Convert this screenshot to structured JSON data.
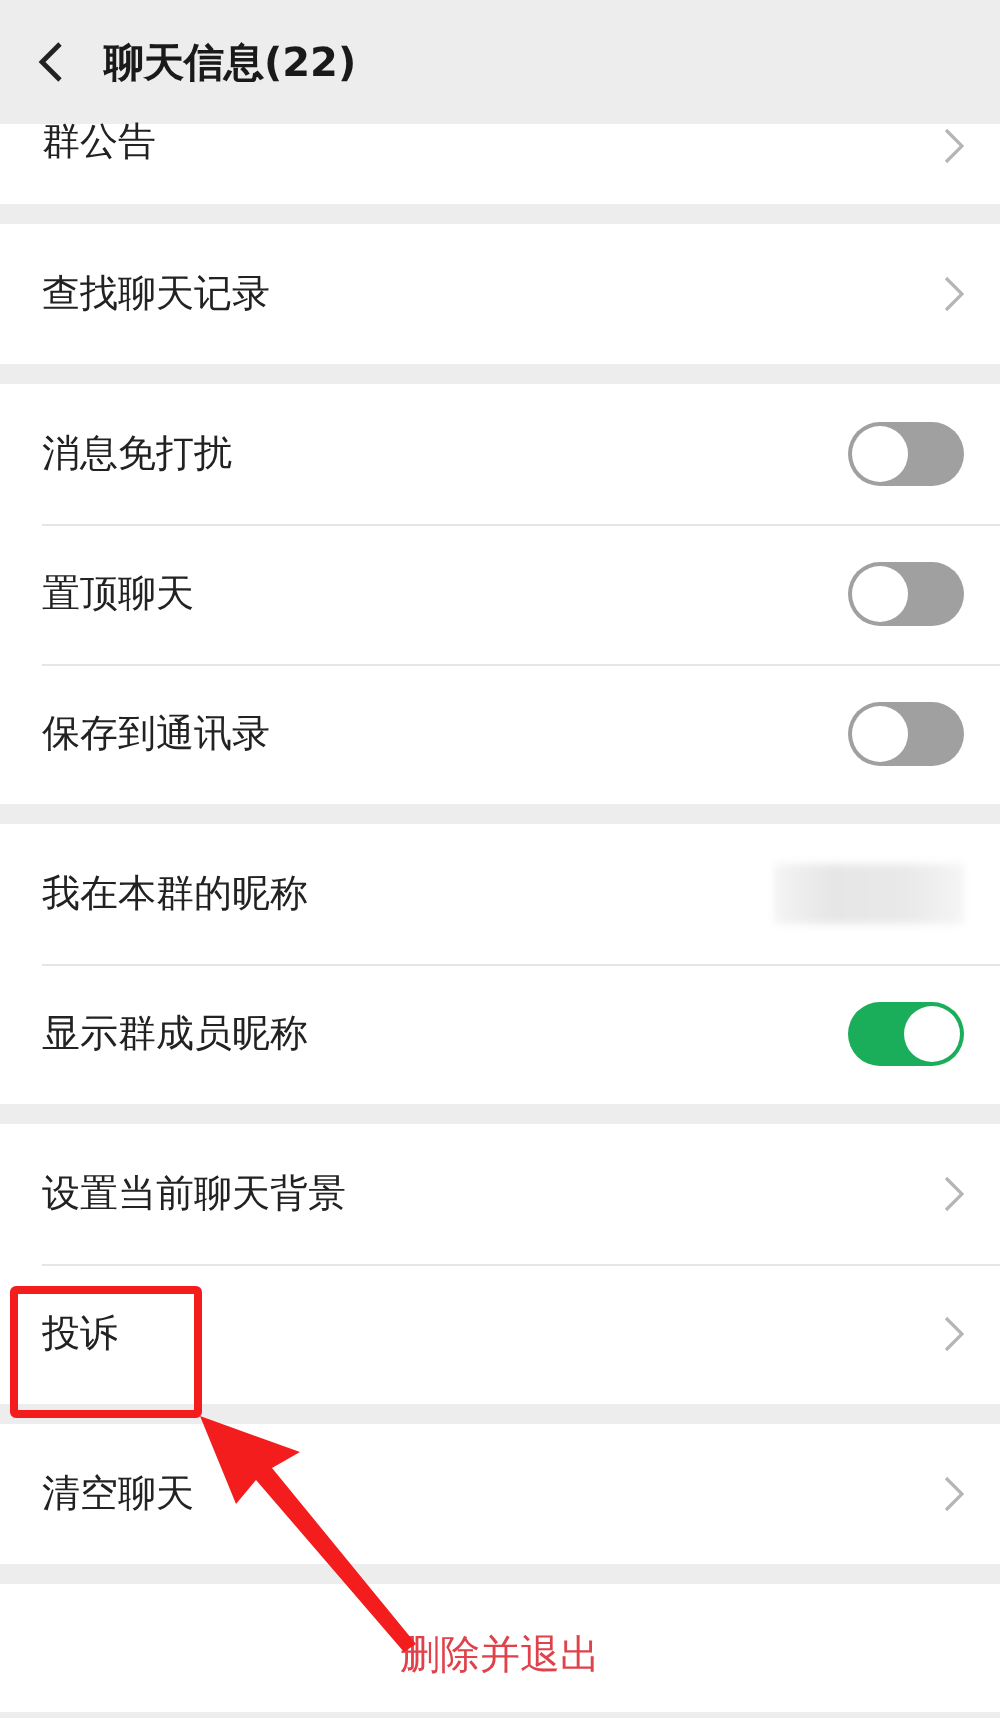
{
  "header": {
    "title": "聊天信息(22)"
  },
  "sections": [
    {
      "rows": [
        {
          "kind": "link",
          "label": "群公告"
        }
      ]
    },
    {
      "rows": [
        {
          "kind": "link",
          "label": "查找聊天记录"
        }
      ]
    },
    {
      "rows": [
        {
          "kind": "toggle",
          "label": "消息免打扰",
          "on": false
        },
        {
          "kind": "toggle",
          "label": "置顶聊天",
          "on": false
        },
        {
          "kind": "toggle",
          "label": "保存到通讯录",
          "on": false
        }
      ]
    },
    {
      "rows": [
        {
          "kind": "blurred",
          "label": "我在本群的昵称"
        },
        {
          "kind": "toggle",
          "label": "显示群成员昵称",
          "on": true
        }
      ]
    },
    {
      "rows": [
        {
          "kind": "link",
          "label": "设置当前聊天背景"
        },
        {
          "kind": "link",
          "label": "投诉"
        }
      ]
    },
    {
      "rows": [
        {
          "kind": "link",
          "label": "清空聊天"
        }
      ]
    }
  ],
  "delete_button": "删除并退出"
}
